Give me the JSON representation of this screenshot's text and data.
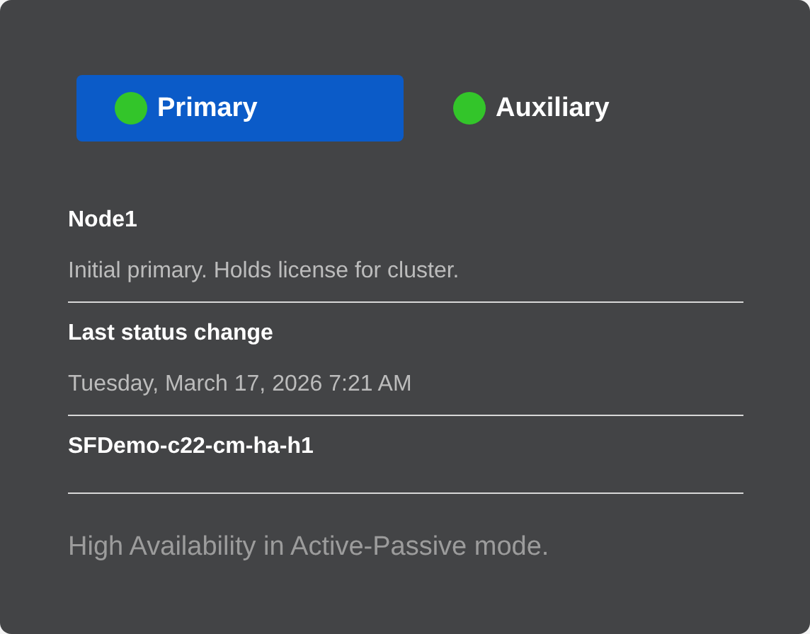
{
  "tabs": [
    {
      "label": "Primary",
      "selected": true,
      "color": "#33c52a"
    },
    {
      "label": "Auxiliary",
      "selected": false,
      "color": "#33c52a"
    }
  ],
  "details": [
    {
      "title": "Node1",
      "value": "Initial primary. Holds license for cluster."
    },
    {
      "title": "Last status change",
      "value": "Tuesday, March 17, 2026 7:21 AM"
    },
    {
      "title": "SFDemo-c22-cm-ha-h1"
    }
  ],
  "footer": "High Availability in Active-Passive mode."
}
